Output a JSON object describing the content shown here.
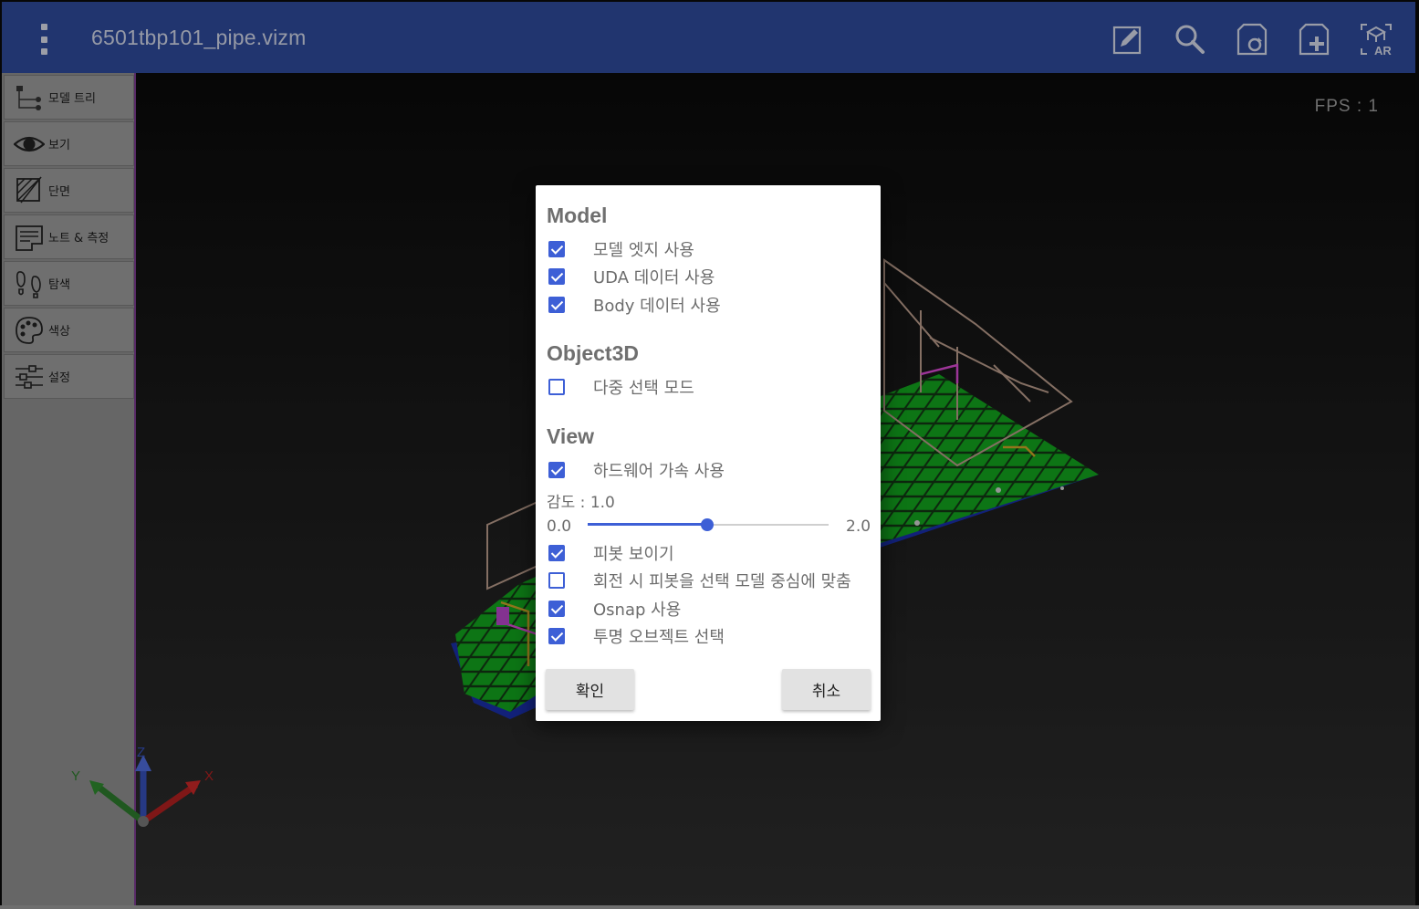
{
  "app": {
    "title": "6501tbp101_pipe.vizm",
    "toolbar_icons": [
      "edit-icon",
      "search-icon",
      "file-refresh-icon",
      "file-add-icon",
      "ar-icon"
    ]
  },
  "viewport": {
    "fps_text": "FPS : 1"
  },
  "sidebar": {
    "items": [
      {
        "label": "모델 트리",
        "icon": "tree-icon"
      },
      {
        "label": "보기",
        "icon": "eye-icon"
      },
      {
        "label": "단면",
        "icon": "section-icon"
      },
      {
        "label": "노트 & 측정",
        "icon": "note-icon"
      },
      {
        "label": "탐색",
        "icon": "footprint-icon"
      },
      {
        "label": "색상",
        "icon": "palette-icon"
      },
      {
        "label": "설정",
        "icon": "sliders-icon"
      }
    ]
  },
  "axes": {
    "x_label": "X",
    "y_label": "Y",
    "z_label": "Z"
  },
  "dialog": {
    "sections": {
      "model": "Model",
      "object3d": "Object3D",
      "view": "View"
    },
    "options": {
      "model_edge": {
        "label": "모델 엣지 사용",
        "checked": true
      },
      "uda_data": {
        "label": "UDA 데이터 사용",
        "checked": true
      },
      "body_data": {
        "label": "Body 데이터 사용",
        "checked": true
      },
      "multi_select": {
        "label": "다중 선택 모드",
        "checked": false
      },
      "hw_accel": {
        "label": "하드웨어 가속 사용",
        "checked": true
      },
      "show_pivot": {
        "label": "피봇 보이기",
        "checked": true
      },
      "pivot_center": {
        "label": "회전 시 피봇을 선택 모델 중심에 맞춤",
        "checked": false
      },
      "osnap": {
        "label": "Osnap 사용",
        "checked": true
      },
      "transparent_select": {
        "label": "투명 오브젝트 선택",
        "checked": true
      }
    },
    "sensitivity": {
      "label": "감도 : 1.0",
      "value": 1.0,
      "min_label": "0.0",
      "max_label": "2.0"
    },
    "ok_label": "확인",
    "cancel_label": "취소"
  },
  "colors": {
    "appbar": "#2f4a9a",
    "accent": "#3d5fd6",
    "sidebar": "#9a9a9a"
  }
}
